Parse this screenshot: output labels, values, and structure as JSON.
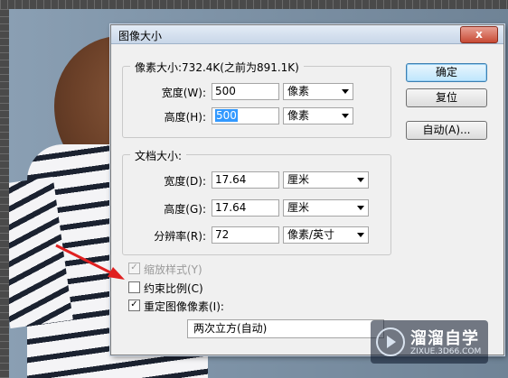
{
  "dialog": {
    "title": "图像大小",
    "close_label": "x",
    "pixel_dimensions": {
      "heading": "像素大小:732.4K(之前为891.1K)",
      "width_label": "宽度(W):",
      "width_value": "500",
      "width_unit": "像素",
      "height_label": "高度(H):",
      "height_value": "500",
      "height_unit": "像素"
    },
    "document_size": {
      "heading": "文档大小:",
      "width_label": "宽度(D):",
      "width_value": "17.64",
      "width_unit": "厘米",
      "height_label": "高度(G):",
      "height_value": "17.64",
      "height_unit": "厘米",
      "resolution_label": "分辨率(R):",
      "resolution_value": "72",
      "resolution_unit": "像素/英寸"
    },
    "buttons": {
      "ok": "确定",
      "reset": "复位",
      "auto": "自动(A)..."
    },
    "options": {
      "scale_styles": {
        "label": "缩放样式(Y)",
        "checked": true,
        "enabled": false
      },
      "constrain_proportions": {
        "label": "约束比例(C)",
        "checked": false,
        "enabled": true
      },
      "resample_image": {
        "label": "重定图像像素(I):",
        "checked": true,
        "enabled": true
      },
      "resample_method": "两次立方(自动)"
    }
  },
  "watermark": {
    "brand": "溜溜自学",
    "url": "ZIXUE.3D66.COM"
  },
  "colors": {
    "annotation_arrow": "#e02020",
    "titlebar": "#c8d6e8",
    "close_button": "#c74a35"
  }
}
